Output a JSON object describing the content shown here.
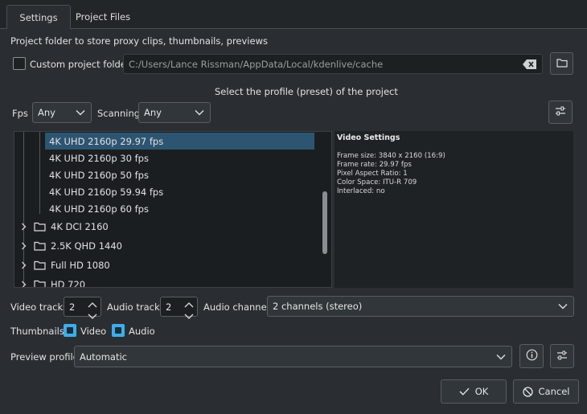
{
  "tabs": [
    {
      "label": "Settings",
      "active": true
    },
    {
      "label": "Project Files",
      "active": false
    }
  ],
  "project_folder": {
    "heading": "Project folder to store proxy clips, thumbnails, previews",
    "custom_label": "Custom project folder",
    "custom_checked": false,
    "path_placeholder": "C:/Users/Lance Rissman/AppData/Local/kdenlive/cache"
  },
  "profile": {
    "heading": "Select the profile (preset) of the project",
    "fps_label": "Fps",
    "fps_value": "Any",
    "scanning_label": "Scanning",
    "scanning_value": "Any",
    "tree": [
      {
        "label": "4K UHD 2160p 29.97 fps",
        "type": "leaf",
        "selected": true
      },
      {
        "label": "4K UHD 2160p 30 fps",
        "type": "leaf",
        "selected": false
      },
      {
        "label": "4K UHD 2160p 50 fps",
        "type": "leaf",
        "selected": false
      },
      {
        "label": "4K UHD 2160p 59.94 fps",
        "type": "leaf",
        "selected": false
      },
      {
        "label": "4K UHD 2160p 60 fps",
        "type": "leaf",
        "selected": false
      },
      {
        "label": "4K DCI 2160",
        "type": "folder",
        "selected": false
      },
      {
        "label": "2.5K QHD 1440",
        "type": "folder",
        "selected": false
      },
      {
        "label": "Full HD 1080",
        "type": "folder",
        "selected": false
      },
      {
        "label": "HD 720",
        "type": "folder",
        "selected": false
      }
    ],
    "video_settings": {
      "title": "Video Settings",
      "lines": [
        "Frame size: 3840 x 2160 (16:9)",
        "Frame rate: 29.97 fps",
        "Pixel Aspect Ratio: 1",
        "Color Space: ITU-R 709",
        "Interlaced: no"
      ]
    }
  },
  "tracks": {
    "video_label": "Video tracks",
    "video_value": "2",
    "audio_label": "Audio tracks",
    "audio_value": "2",
    "channels_label": "Audio channels",
    "channels_value": "2 channels (stereo)"
  },
  "thumbnails": {
    "label": "Thumbnails:",
    "video_label": "Video",
    "video_checked": true,
    "audio_label": "Audio",
    "audio_checked": true
  },
  "preview": {
    "label": "Preview profile",
    "value": "Automatic"
  },
  "buttons": {
    "ok": "OK",
    "cancel": "Cancel"
  },
  "colors": {
    "accent": "#3daee9",
    "selection": "#2d5572",
    "background": "#2a2e32"
  }
}
